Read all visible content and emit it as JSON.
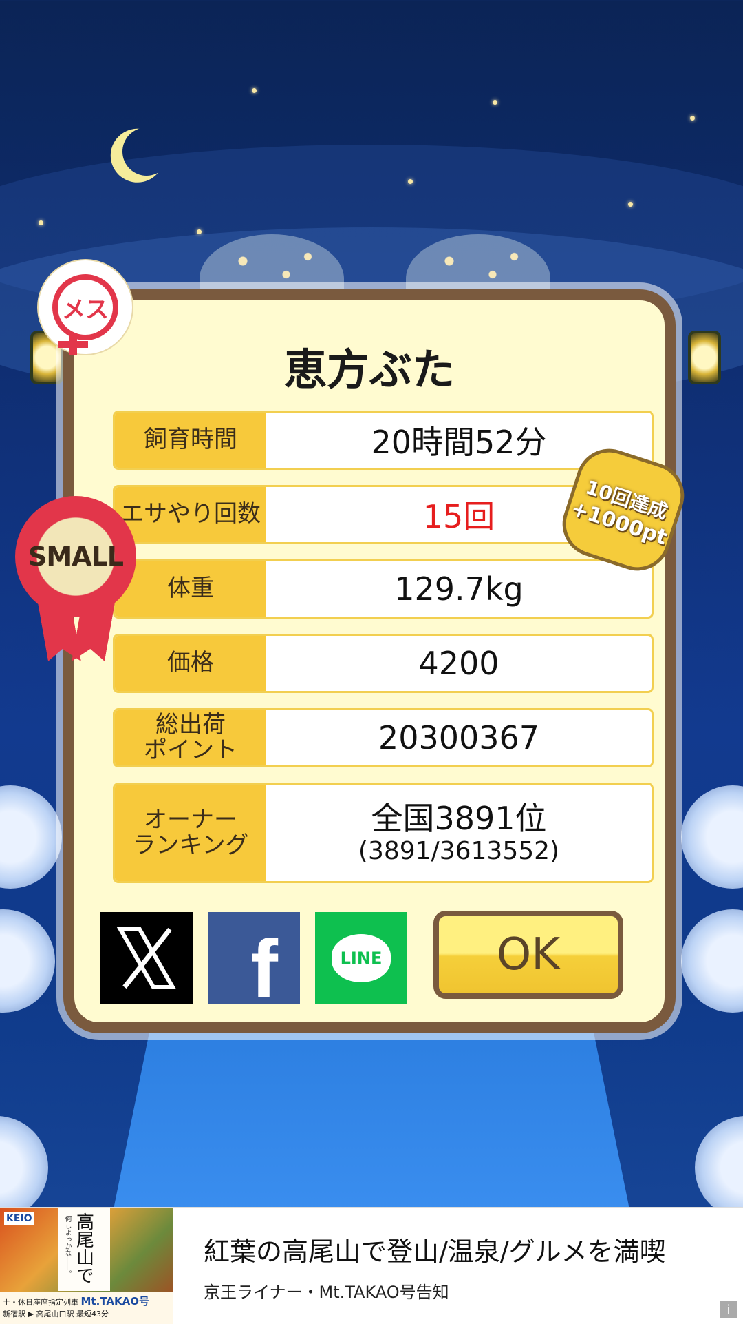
{
  "dialog": {
    "name": "恵方ぶた",
    "rows": [
      {
        "label": "飼育時間",
        "value": "20時間52分"
      },
      {
        "label": "エサやり回数",
        "value": "15回"
      },
      {
        "label": "体重",
        "value": "129.7kg"
      },
      {
        "label": "価格",
        "value": "4200"
      },
      {
        "label": "総出荷\nポイント",
        "value": "20300367"
      },
      {
        "label": "オーナー\nランキング",
        "value": "全国3891位",
        "value_sub": "(3891/3613552)"
      }
    ],
    "ok_label": "OK"
  },
  "badges": {
    "gender": "メス",
    "size": "SMALL",
    "bonus_line1": "10回達成",
    "bonus_line2": "+1000pt"
  },
  "share": {
    "x_label": "X",
    "facebook_label": "f",
    "line_label": "LINE"
  },
  "ad": {
    "title": "紅葉の高尾山で登山/温泉/グルメを満喫",
    "subtitle": "京王ライナー・Mt.TAKAO号告知",
    "thumb_brand": "KEIO",
    "thumb_vertical": "高尾山で",
    "thumb_vertical_small": "何しよっかな――。",
    "thumb_train": "Mt.TAKAO号",
    "thumb_route": "新宿駅 ▶ 高尾山口駅 最短43分",
    "thumb_note": "土・休日座席指定列車",
    "info_icon": "i"
  },
  "colors": {
    "accent_yellow": "#f7c93b",
    "dialog_bg": "#fffbd0",
    "border_brown": "#7a5a3e",
    "highlight_red": "#e61e1e",
    "facebook_blue": "#3b5997",
    "line_green": "#0ec04f"
  }
}
